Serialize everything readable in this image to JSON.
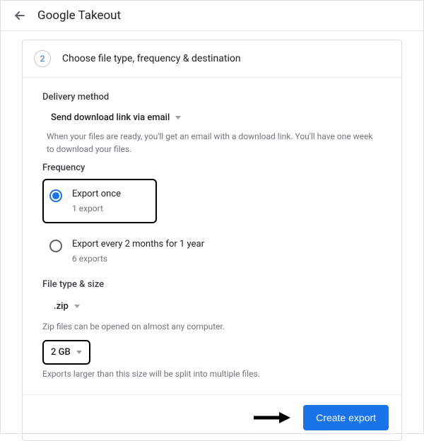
{
  "app": {
    "title": "Google Takeout"
  },
  "step": {
    "number": "2",
    "title": "Choose file type, frequency & destination"
  },
  "delivery": {
    "label": "Delivery method",
    "selected": "Send download link via email",
    "helper": "When your files are ready, you'll get an email with a download link. You'll have one week to download your files."
  },
  "frequency": {
    "label": "Frequency",
    "options": [
      {
        "title": "Export once",
        "sub": "1 export",
        "selected": true
      },
      {
        "title": "Export every 2 months for 1 year",
        "sub": "6 exports",
        "selected": false
      }
    ]
  },
  "filetype": {
    "label": "File type & size",
    "type_selected": ".zip",
    "type_helper": "Zip files can be opened on almost any computer.",
    "size_selected": "2 GB",
    "size_helper": "Exports larger than this size will be split into multiple files."
  },
  "actions": {
    "create_export": "Create export"
  }
}
